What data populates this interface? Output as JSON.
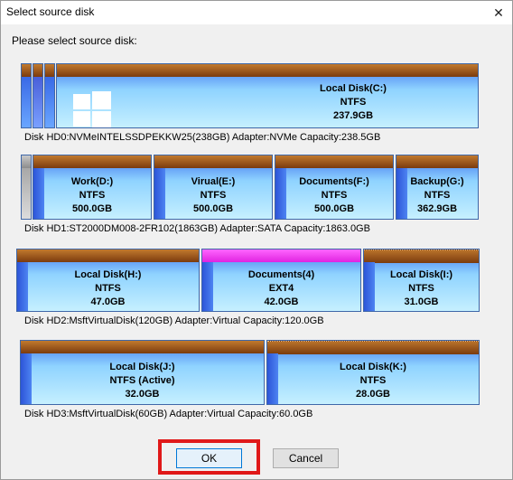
{
  "window": {
    "title": "Select source disk",
    "close_glyph": "✕"
  },
  "prompt": "Please select source disk:",
  "disks": [
    {
      "info": "Disk HD0:NVMeINTELSSDPEKKW25(238GB)  Adapter:NVMe  Capacity:238.5GB",
      "partitions": [
        {
          "name": "Local Disk(C:)",
          "fs": "NTFS",
          "size": "237.9GB"
        }
      ]
    },
    {
      "info": "Disk HD1:ST2000DM008-2FR102(1863GB)  Adapter:SATA  Capacity:1863.0GB",
      "partitions": [
        {
          "name": "Work(D:)",
          "fs": "NTFS",
          "size": "500.0GB"
        },
        {
          "name": "Virual(E:)",
          "fs": "NTFS",
          "size": "500.0GB"
        },
        {
          "name": "Documents(F:)",
          "fs": "NTFS",
          "size": "500.0GB"
        },
        {
          "name": "Backup(G:)",
          "fs": "NTFS",
          "size": "362.9GB"
        }
      ]
    },
    {
      "info": "Disk HD2:MsftVirtualDisk(120GB)  Adapter:Virtual  Capacity:120.0GB",
      "partitions": [
        {
          "name": "Local Disk(H:)",
          "fs": "NTFS",
          "size": "47.0GB"
        },
        {
          "name": "Documents(4)",
          "fs": "EXT4",
          "size": "42.0GB"
        },
        {
          "name": "Local Disk(I:)",
          "fs": "NTFS",
          "size": "31.0GB"
        }
      ]
    },
    {
      "info": "Disk HD3:MsftVirtualDisk(60GB)  Adapter:Virtual  Capacity:60.0GB",
      "partitions": [
        {
          "name": "Local Disk(J:)",
          "fs": "NTFS (Active)",
          "size": "32.0GB"
        },
        {
          "name": "Local Disk(K:)",
          "fs": "NTFS",
          "size": "28.0GB"
        }
      ]
    }
  ],
  "buttons": {
    "ok": "OK",
    "cancel": "Cancel"
  },
  "colors": {
    "highlight": "#e01818",
    "partition_cap": "#7b3b0e",
    "ext4_cap": "#e023e0"
  }
}
